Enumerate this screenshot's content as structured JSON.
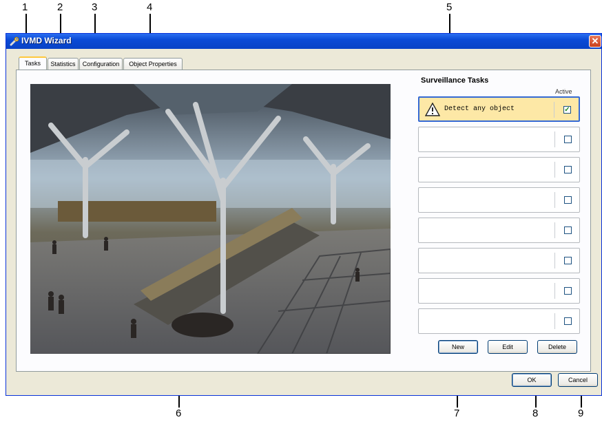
{
  "callouts": [
    "1",
    "2",
    "3",
    "4",
    "5",
    "6",
    "7",
    "8",
    "9"
  ],
  "window": {
    "title": "IVMD Wizard",
    "close_glyph": "✕"
  },
  "tabs": [
    {
      "label": "Tasks",
      "active": true
    },
    {
      "label": "Statistics",
      "active": false
    },
    {
      "label": "Configuration",
      "active": false
    },
    {
      "label": "Object Properties",
      "active": false
    }
  ],
  "surveillance": {
    "title": "Surveillance Tasks",
    "active_header": "Active",
    "tasks": [
      {
        "name": "Detect any object",
        "icon": "warning-icon",
        "active": true,
        "selected": true
      },
      {
        "name": "",
        "active": false
      },
      {
        "name": "",
        "active": false
      },
      {
        "name": "",
        "active": false
      },
      {
        "name": "",
        "active": false
      },
      {
        "name": "",
        "active": false
      },
      {
        "name": "",
        "active": false
      },
      {
        "name": "",
        "active": false
      }
    ],
    "buttons": {
      "new": "New",
      "edit": "Edit",
      "delete": "Delete"
    }
  },
  "footer": {
    "ok": "OK",
    "cancel": "Cancel"
  },
  "colors": {
    "titlebar": "#0a4ad6",
    "selected_row": "#fde8a6",
    "selected_border": "#3469d4",
    "tab_highlight": "#ffc83c"
  }
}
